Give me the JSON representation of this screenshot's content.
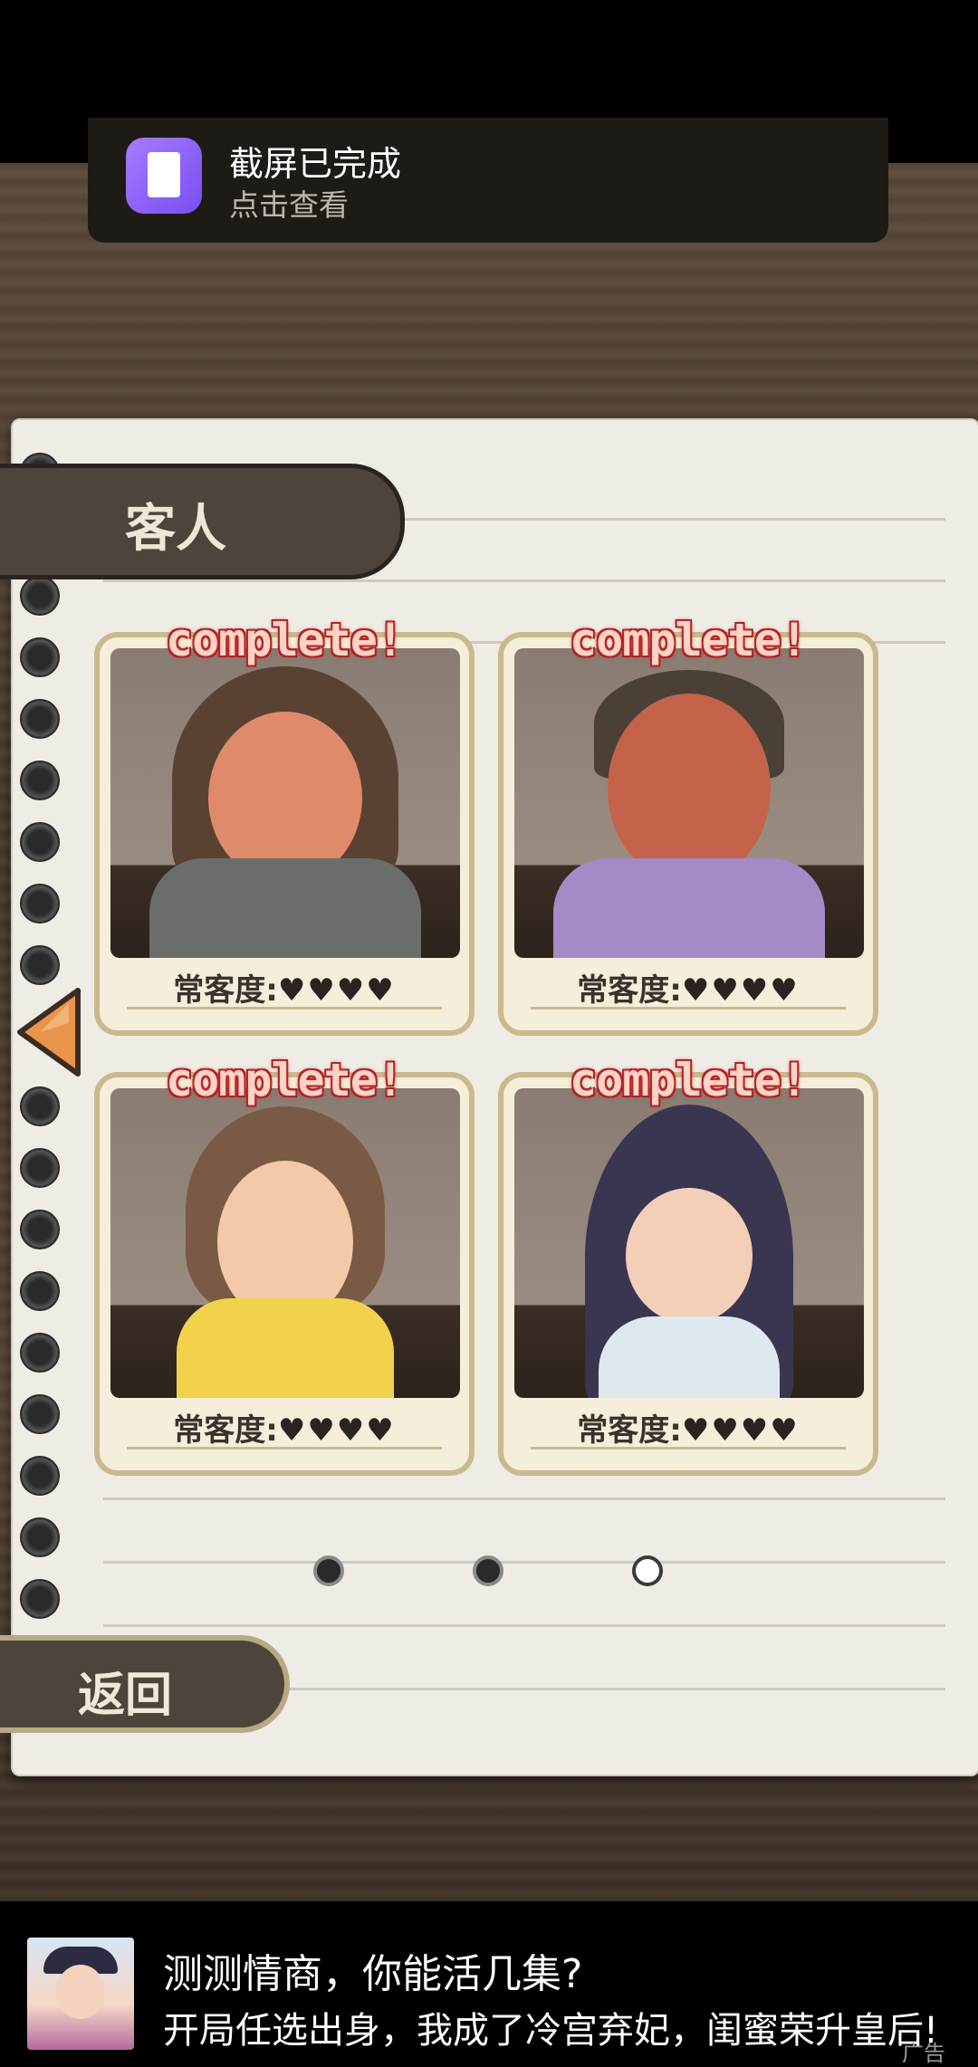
{
  "notification": {
    "title": "截屏已完成",
    "subtitle": "点击查看"
  },
  "notebook": {
    "section_title": "客人",
    "cards": [
      {
        "status": "complete!",
        "meter_label": "常客度:",
        "hearts": "♥♥♥♥",
        "hearts_filled": 4,
        "character": "long-haired-man"
      },
      {
        "status": "complete!",
        "meter_label": "常客度:",
        "hearts": "♥♥♥♥",
        "hearts_filled": 4,
        "character": "purple-suit-man"
      },
      {
        "status": "complete!",
        "meter_label": "常客度:",
        "hearts": "♥♥♥♥",
        "hearts_filled": 4,
        "character": "bob-haired-woman"
      },
      {
        "status": "complete!",
        "meter_label": "常客度:",
        "hearts": "♥♥♥♥",
        "hearts_filled": 4,
        "character": "black-haired-girl"
      }
    ],
    "pagination": {
      "pages": 3,
      "current": 3
    },
    "back_label": "返回"
  },
  "ad": {
    "title": "测测情商，你能活几集?",
    "subtitle": "开局任选出身，我成了冷宫弃妃，闺蜜荣升皇后!",
    "tag": "广告"
  },
  "colors": {
    "heart": "#2a2420",
    "complete_text": "#ffd3c6",
    "complete_outline": "#c03030",
    "card_border": "#cbb98e",
    "tab_bg": "#4d443c"
  }
}
